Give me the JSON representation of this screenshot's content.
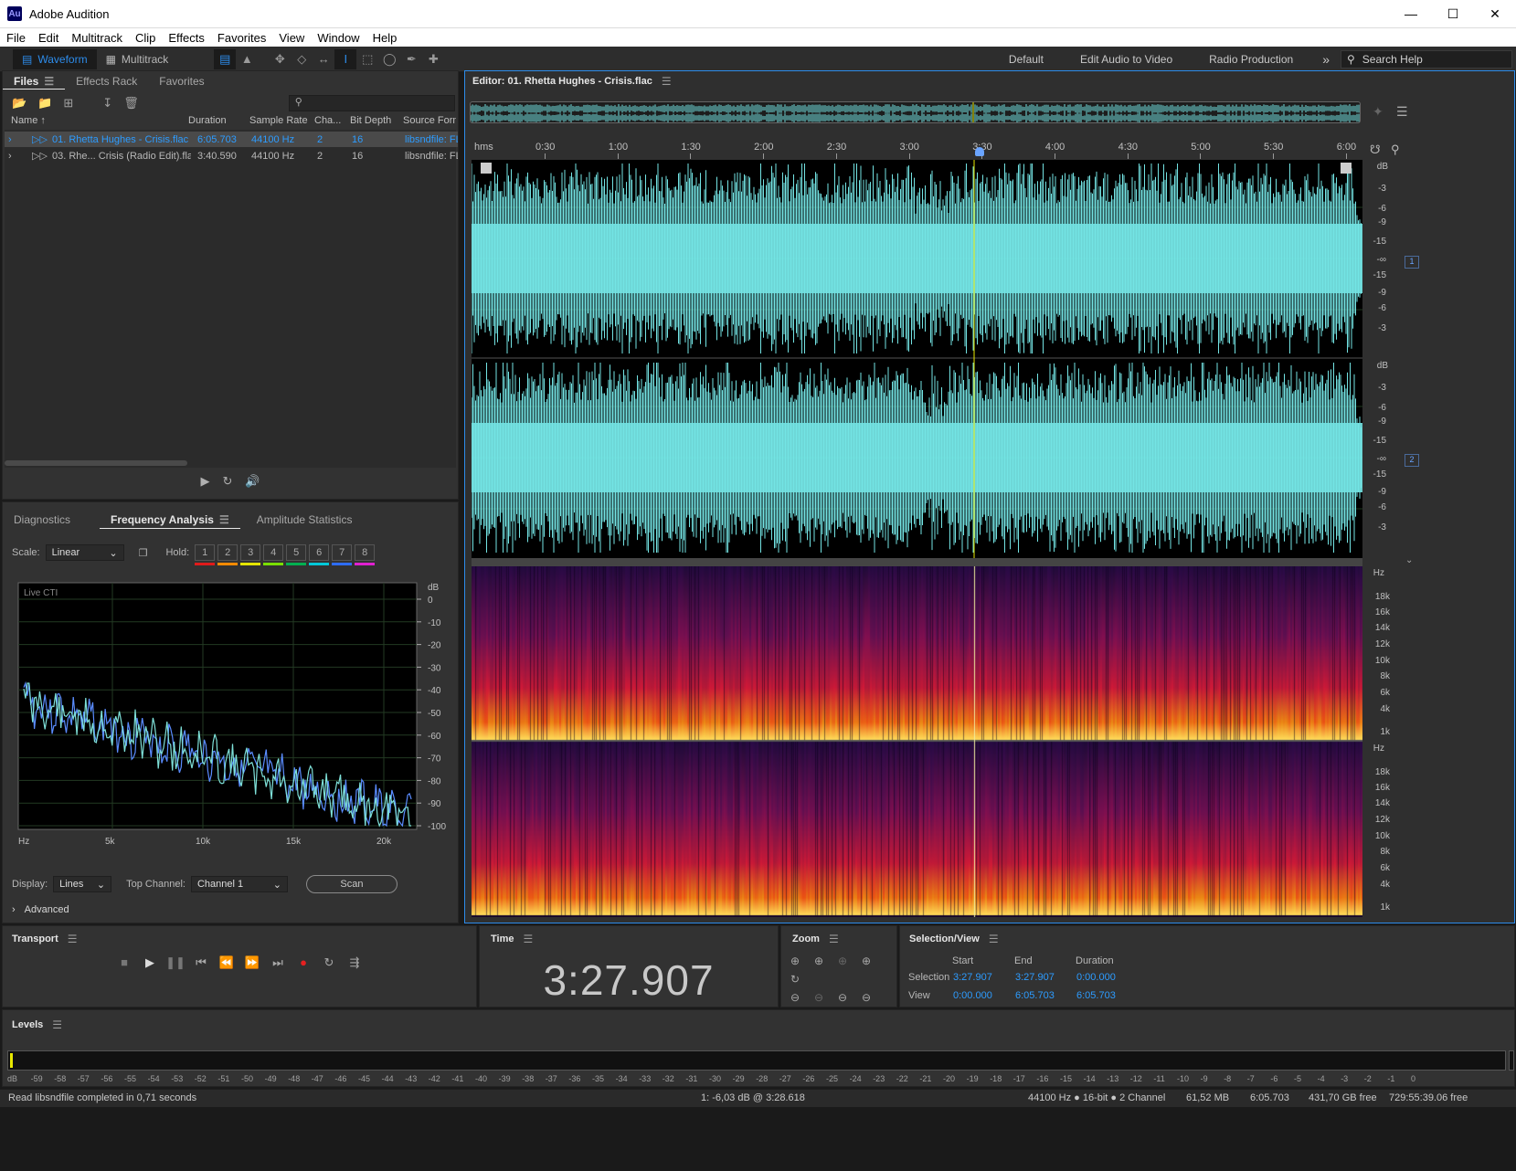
{
  "app": {
    "title": "Adobe Audition",
    "logo": "Au"
  },
  "menu": [
    "File",
    "Edit",
    "Multitrack",
    "Clip",
    "Effects",
    "Favorites",
    "View",
    "Window",
    "Help"
  ],
  "toolbar": {
    "waveform_label": "Waveform",
    "multitrack_label": "Multitrack",
    "workspaces": [
      "Default",
      "Edit Audio to Video",
      "Radio Production"
    ],
    "more": "»",
    "search_placeholder": "Search Help"
  },
  "files_panel": {
    "tabs": [
      "Files",
      "Effects Rack",
      "Favorites"
    ],
    "columns": [
      "Name ↑",
      "Duration",
      "Sample Rate",
      "Cha...",
      "Bit Depth",
      "Source Form"
    ],
    "rows": [
      {
        "name": "01. Rhetta Hughes - Crisis.flac",
        "duration": "6:05.703",
        "rate": "44100 Hz",
        "channels": "2",
        "depth": "16",
        "format": "libsndfile: FL",
        "selected": true
      },
      {
        "name": "03. Rhe... Crisis (Radio Edit).flac",
        "duration": "3:40.590",
        "rate": "44100 Hz",
        "channels": "2",
        "depth": "16",
        "format": "libsndfile: FL",
        "selected": false
      }
    ]
  },
  "analysis_panel": {
    "tabs": [
      "Diagnostics",
      "Frequency Analysis",
      "Amplitude Statistics"
    ],
    "scale_label": "Scale:",
    "scale_value": "Linear",
    "hold_label": "Hold:",
    "hold_buttons": [
      "1",
      "2",
      "3",
      "4",
      "5",
      "6",
      "7",
      "8"
    ],
    "hold_colors": [
      "#e01b1b",
      "#ff8a00",
      "#e5e500",
      "#7adf00",
      "#00b050",
      "#00c8d8",
      "#2d6cff",
      "#e020d0"
    ],
    "graph_caption": "Live CTI",
    "db_unit": "dB",
    "db_ticks": [
      "0",
      "-10",
      "-20",
      "-30",
      "-40",
      "-50",
      "-60",
      "-70",
      "-80",
      "-90",
      "-100"
    ],
    "hz_ticks": [
      "Hz",
      "5k",
      "10k",
      "15k",
      "20k"
    ],
    "display_label": "Display:",
    "display_value": "Lines",
    "top_channel_label": "Top Channel:",
    "top_channel_value": "Channel 1",
    "scan_label": "Scan",
    "advanced_label": "Advanced"
  },
  "editor": {
    "title": "Editor: 01. Rhetta Hughes - Crisis.flac",
    "ruler_unit": "hms",
    "ruler_ticks": [
      "0:30",
      "1:00",
      "1:30",
      "2:00",
      "2:30",
      "3:00",
      "3:30",
      "4:00",
      "4:30",
      "5:00",
      "5:30",
      "6:00"
    ],
    "db_unit": "dB",
    "db_scale": [
      "-3",
      "-6",
      "-9",
      "-15",
      "-∞",
      "-15",
      "-9",
      "-6",
      "-3"
    ],
    "channel_badges": [
      "1",
      "2"
    ],
    "hz_unit": "Hz",
    "hz_scale": [
      "18k",
      "16k",
      "14k",
      "12k",
      "10k",
      "8k",
      "6k",
      "4k",
      "1k"
    ],
    "waveform_color": "#73e3e3",
    "playhead_color": "#e8e800"
  },
  "transport": {
    "title": "Transport"
  },
  "time": {
    "title": "Time",
    "value": "3:27.907"
  },
  "zoom": {
    "title": "Zoom"
  },
  "selection_view": {
    "title": "Selection/View",
    "headers": [
      "Start",
      "End",
      "Duration"
    ],
    "rows": [
      {
        "label": "Selection",
        "start": "3:27.907",
        "end": "3:27.907",
        "duration": "0:00.000"
      },
      {
        "label": "View",
        "start": "0:00.000",
        "end": "6:05.703",
        "duration": "6:05.703"
      }
    ]
  },
  "levels": {
    "title": "Levels",
    "ticks": [
      "dB",
      "-59",
      "-58",
      "-57",
      "-56",
      "-55",
      "-54",
      "-53",
      "-52",
      "-51",
      "-50",
      "-49",
      "-48",
      "-47",
      "-46",
      "-45",
      "-44",
      "-43",
      "-42",
      "-41",
      "-40",
      "-39",
      "-38",
      "-37",
      "-36",
      "-35",
      "-34",
      "-33",
      "-32",
      "-31",
      "-30",
      "-29",
      "-28",
      "-27",
      "-26",
      "-25",
      "-24",
      "-23",
      "-22",
      "-21",
      "-20",
      "-19",
      "-18",
      "-17",
      "-16",
      "-15",
      "-14",
      "-13",
      "-12",
      "-11",
      "-10",
      "-9",
      "-8",
      "-7",
      "-6",
      "-5",
      "-4",
      "-3",
      "-2",
      "-1",
      "0"
    ]
  },
  "status": {
    "message": "Read libsndfile completed in 0,71 seconds",
    "cursor": "1: -6,03 dB @ 3:28.618",
    "format": "44100 Hz ● 16-bit ● 2 Channel",
    "size": "61,52 MB",
    "duration": "6:05.703",
    "free": "431,70 GB free",
    "free_time": "729:55:39.06 free"
  }
}
